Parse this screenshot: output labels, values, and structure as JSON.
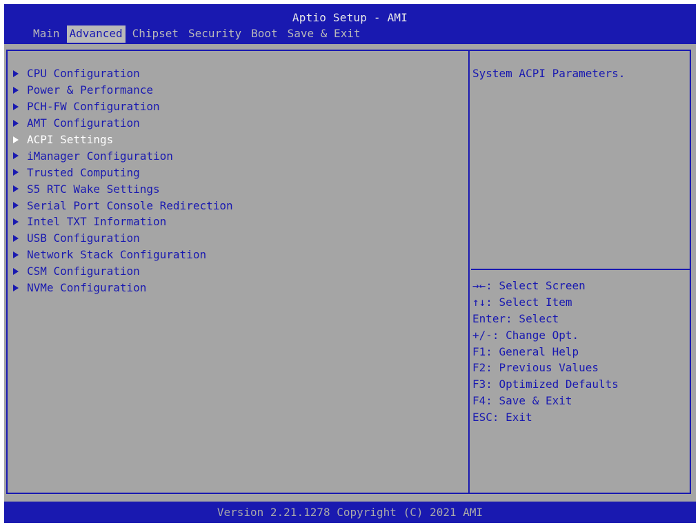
{
  "app_title": "Aptio Setup - AMI",
  "tabs": [
    {
      "label": "Main"
    },
    {
      "label": "Advanced",
      "active": true
    },
    {
      "label": "Chipset"
    },
    {
      "label": "Security"
    },
    {
      "label": "Boot"
    },
    {
      "label": "Save & Exit"
    }
  ],
  "menu": {
    "selected_index": 4,
    "items": [
      {
        "label": "CPU Configuration"
      },
      {
        "label": "Power & Performance"
      },
      {
        "label": "PCH-FW Configuration"
      },
      {
        "label": "AMT Configuration"
      },
      {
        "label": "ACPI Settings"
      },
      {
        "label": "iManager Configuration"
      },
      {
        "label": "Trusted Computing"
      },
      {
        "label": "S5 RTC Wake Settings"
      },
      {
        "label": "Serial Port Console Redirection"
      },
      {
        "label": "Intel TXT Information"
      },
      {
        "label": "USB Configuration"
      },
      {
        "label": "Network Stack Configuration"
      },
      {
        "label": "CSM Configuration"
      },
      {
        "label": "NVMe Configuration"
      }
    ]
  },
  "help": {
    "description": "System ACPI Parameters.",
    "keys": [
      "→←: Select Screen",
      "↑↓: Select Item",
      "Enter: Select",
      "+/-: Change Opt.",
      "F1: General Help",
      "F2: Previous Values",
      "F3: Optimized Defaults",
      "F4: Save & Exit",
      "ESC: Exit"
    ]
  },
  "footer": {
    "version_text": "Version 2.21.1278 Copyright (C) 2021 AMI"
  },
  "colors": {
    "bios_blue": "#1919b0",
    "panel_gray": "#a5a5a5",
    "highlight_white": "#ffffff",
    "tab_gray": "#b9b9b9"
  }
}
